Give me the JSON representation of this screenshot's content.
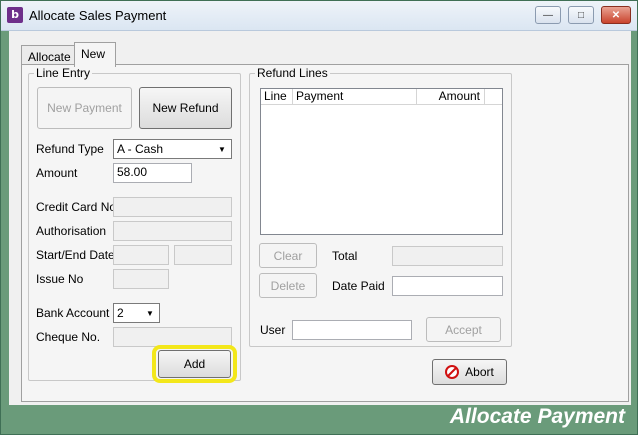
{
  "window": {
    "title": "Allocate Sales Payment",
    "icon_letter": "b",
    "controls": {
      "minimize": "—",
      "maximize": "□",
      "close": "✕"
    }
  },
  "tabs": [
    {
      "label": "Allocate",
      "active": false
    },
    {
      "label": "New",
      "active": true
    }
  ],
  "line_entry": {
    "legend": "Line Entry",
    "new_payment_label": "New Payment",
    "new_refund_label": "New Refund",
    "refund_type_label": "Refund Type",
    "refund_type_value": "A - Cash",
    "amount_label": "Amount",
    "amount_value": "58.00",
    "credit_card_label": "Credit Card No",
    "authorisation_label": "Authorisation",
    "start_end_label": "Start/End Date",
    "issue_no_label": "Issue No",
    "bank_account_label": "Bank Account",
    "bank_account_value": "2",
    "cheque_label": "Cheque No.",
    "add_label": "Add"
  },
  "refund_lines": {
    "legend": "Refund Lines",
    "columns": [
      "Line",
      "Payment",
      "Amount"
    ],
    "clear_label": "Clear",
    "delete_label": "Delete",
    "total_label": "Total",
    "date_paid_label": "Date Paid",
    "user_label": "User",
    "accept_label": "Accept"
  },
  "abort_label": "Abort",
  "footer_title": "Allocate Payment",
  "colors": {
    "frame": "#6a9b7a",
    "highlight": "#f3e71a"
  }
}
